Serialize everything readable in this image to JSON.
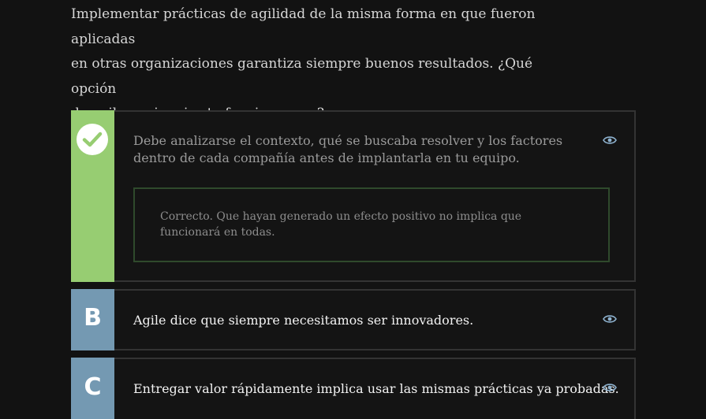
{
  "question": {
    "lines": [
      "Implementar prácticas de agilidad de la misma forma en que fueron aplicadas",
      "en otras organizaciones garantiza siempre buenos resultados. ¿Qué opción",
      "describe mejor si esto funciona o no?"
    ]
  },
  "options": [
    {
      "state": "correct",
      "badge_icon": "check-icon",
      "text": "Debe analizarse el contexto, qué se buscaba resolver y los factores dentro de cada compañía antes de implantarla en tu equipo.",
      "feedback": "Correcto. Que hayan generado un efecto positivo no implica que funcionará en todas.",
      "action_icon": "eye-icon"
    },
    {
      "letter": "B",
      "text": "Agile dice que siempre necesitamos ser innovadores.",
      "action_icon": "eye-icon"
    },
    {
      "letter": "C",
      "text": "Entregar valor rápidamente implica usar las mismas prácticas ya probadas.",
      "action_icon": "eye-icon"
    }
  ],
  "colors": {
    "background": "#121212",
    "correct_badge": "#97cd72",
    "letter_badge": "#7499b2",
    "feedback_border": "#2f4a2c",
    "eye_icon": "#8fb3d0"
  }
}
